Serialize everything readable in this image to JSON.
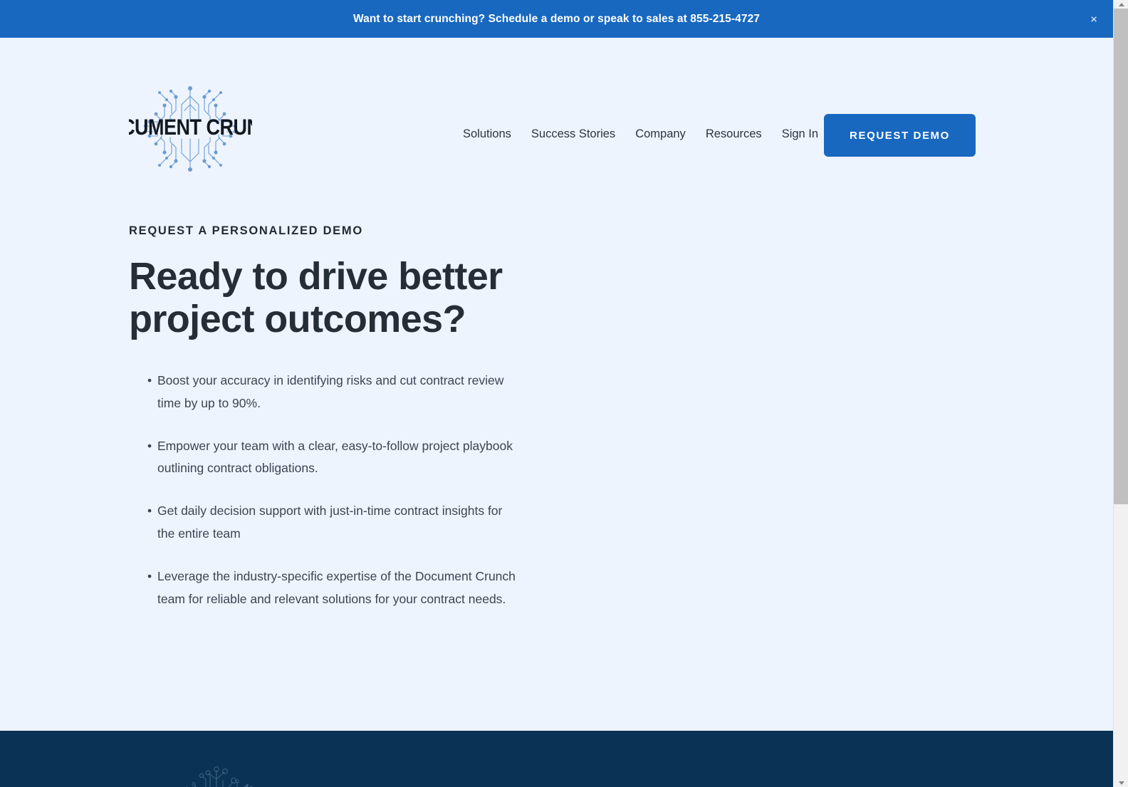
{
  "announcement": {
    "text": "Want to start crunching? Schedule a demo or speak to sales at 855-215-4727",
    "close_label": "×",
    "background_color": "#1868c0",
    "text_color": "#ffffff"
  },
  "header": {
    "logo_text": "DOCUMENT CRUNCH",
    "logo_alt": "Document Crunch circuit logo",
    "nav": [
      {
        "label": "Solutions"
      },
      {
        "label": "Success Stories"
      },
      {
        "label": "Company"
      },
      {
        "label": "Resources"
      },
      {
        "label": "Sign In"
      }
    ],
    "cta": {
      "label": "REQUEST DEMO",
      "background_color": "#1868c0",
      "text_color": "#ffffff"
    }
  },
  "hero": {
    "eyebrow": "REQUEST A PERSONALIZED DEMO",
    "headline": "Ready to drive better project outcomes?",
    "bullet_marker": "•",
    "benefits": [
      "Boost your accuracy in identifying risks and cut contract review time by up to 90%.",
      "Empower your team with a clear, easy-to-follow project playbook outlining contract obligations.",
      "Get daily decision support with just-in-time contract insights for the entire team",
      "Leverage the industry-specific expertise of the Document Crunch team for reliable and relevant solutions for your contract needs."
    ]
  },
  "footer": {
    "background_color": "#093254",
    "graphic_name": "circuit-pattern"
  },
  "theme": {
    "page_background": "#eef4fe",
    "accent_blue": "#1868c0",
    "heading_color": "#252d36",
    "body_text_color": "#3b4552",
    "footer_navy": "#093254"
  },
  "scrollbar": {
    "up_arrow": "▲",
    "down_arrow": "▼"
  }
}
